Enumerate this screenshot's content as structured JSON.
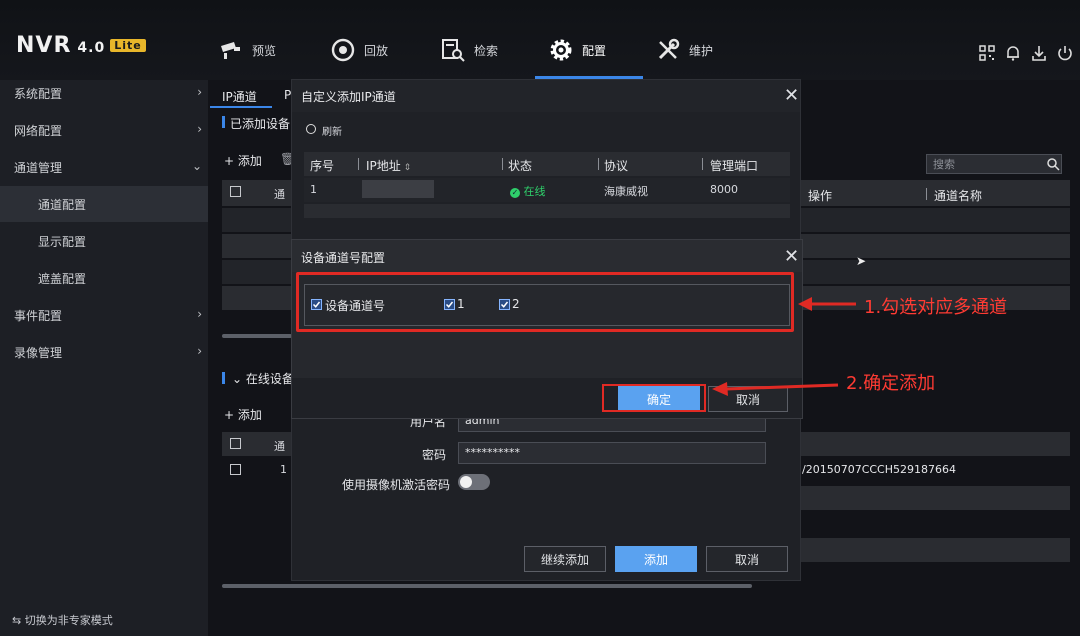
{
  "app": {
    "logo": "NVR",
    "version": "4.0",
    "edition": "Lite"
  },
  "top_nav": {
    "items": [
      {
        "label": "预览",
        "icon": "camera-icon"
      },
      {
        "label": "回放",
        "icon": "playback-icon"
      },
      {
        "label": "检索",
        "icon": "search-file-icon"
      },
      {
        "label": "配置",
        "icon": "gear-icon",
        "active": true
      },
      {
        "label": "维护",
        "icon": "tools-icon"
      }
    ]
  },
  "sidebar": {
    "items": [
      {
        "label": "系统配置"
      },
      {
        "label": "网络配置"
      },
      {
        "label": "通道管理"
      },
      {
        "label": "通道配置"
      },
      {
        "label": "显示配置"
      },
      {
        "label": "遮盖配置"
      },
      {
        "label": "事件配置"
      },
      {
        "label": "录像管理"
      }
    ],
    "footer": "切换为非专家模式"
  },
  "main": {
    "tabs": [
      "IP通道",
      "P"
    ],
    "section_added": "已添加设备",
    "add_label": "添加",
    "bg_col_prefix": "通",
    "search_placeholder": "搜索",
    "columns_right": [
      "操作",
      "通道名称"
    ],
    "online_section": "在线设备",
    "online_add": "添加",
    "online_row_index": "1",
    "online_row_id": "/20150707CCCH529187664"
  },
  "dialog_custom_add": {
    "title": "自定义添加IP通道",
    "refresh": "刷新",
    "columns": [
      "序号",
      "IP地址",
      "状态",
      "协议",
      "管理端口"
    ],
    "row": {
      "index": "1",
      "ip": "",
      "status": "在线",
      "protocol": "海康威视",
      "port": "8000"
    },
    "username_label": "用户名",
    "username_value": "admin",
    "password_label": "密码",
    "password_value": "**********",
    "activation_label": "使用摄像机激活密码",
    "btn_continue": "继续添加",
    "btn_add": "添加",
    "btn_cancel": "取消"
  },
  "dialog_channel_config": {
    "title": "设备通道号配置",
    "label_device_channel": "设备通道号",
    "channels": [
      "1",
      "2"
    ],
    "btn_ok": "确定",
    "btn_cancel": "取消"
  },
  "annotations": {
    "step1": "1.勾选对应多通道",
    "step2": "2.确定添加"
  },
  "colors": {
    "accent": "#3b86e8",
    "primary_button": "#5aa2f0",
    "online": "#2fd06b",
    "annotation": "#ff3b33",
    "logo_badge": "#e8b62a"
  }
}
